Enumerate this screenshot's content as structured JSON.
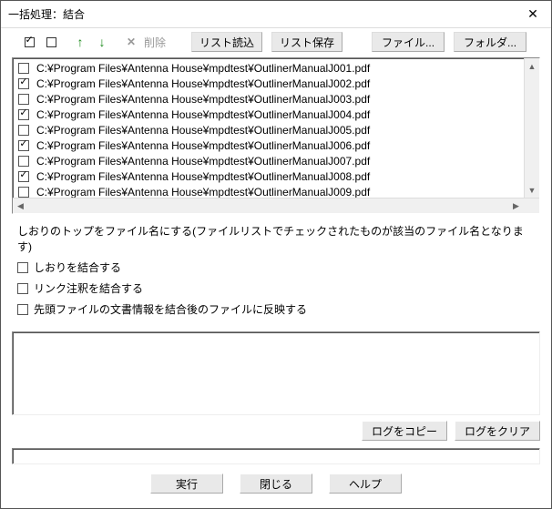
{
  "window": {
    "title": "一括処理：結合"
  },
  "toolbar": {
    "delete_label": "削除",
    "list_load": "リスト読込",
    "list_save": "リスト保存",
    "file": "ファイル...",
    "folder": "フォルダ..."
  },
  "files": [
    {
      "checked": false,
      "path": "C:¥Program Files¥Antenna House¥mpdtest¥OutlinerManualJ001.pdf"
    },
    {
      "checked": true,
      "path": "C:¥Program Files¥Antenna House¥mpdtest¥OutlinerManualJ002.pdf"
    },
    {
      "checked": false,
      "path": "C:¥Program Files¥Antenna House¥mpdtest¥OutlinerManualJ003.pdf"
    },
    {
      "checked": true,
      "path": "C:¥Program Files¥Antenna House¥mpdtest¥OutlinerManualJ004.pdf"
    },
    {
      "checked": false,
      "path": "C:¥Program Files¥Antenna House¥mpdtest¥OutlinerManualJ005.pdf"
    },
    {
      "checked": true,
      "path": "C:¥Program Files¥Antenna House¥mpdtest¥OutlinerManualJ006.pdf"
    },
    {
      "checked": false,
      "path": "C:¥Program Files¥Antenna House¥mpdtest¥OutlinerManualJ007.pdf"
    },
    {
      "checked": true,
      "path": "C:¥Program Files¥Antenna House¥mpdtest¥OutlinerManualJ008.pdf"
    },
    {
      "checked": false,
      "path": "C:¥Program Files¥Antenna House¥mpdtest¥OutlinerManualJ009.pdf"
    }
  ],
  "options": {
    "note": "しおりのトップをファイル名にする(ファイルリストでチェックされたものが該当のファイル名となります)",
    "merge_bookmarks": "しおりを結合する",
    "merge_link_annots": "リンク注釈を結合する",
    "apply_first_docinfo": "先頭ファイルの文書情報を結合後のファイルに反映する"
  },
  "log_buttons": {
    "copy": "ログをコピー",
    "clear": "ログをクリア"
  },
  "bottom": {
    "run": "実行",
    "close": "閉じる",
    "help": "ヘルプ"
  }
}
